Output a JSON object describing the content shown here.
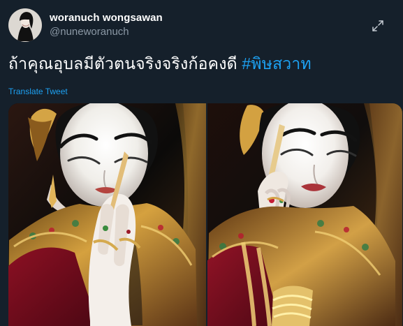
{
  "profile": {
    "display_name": "woranuch wongsawan",
    "handle": "@nuneworanuch"
  },
  "tweet": {
    "text_main": "ถ้าคุณอุบลมีตัวตนจริงจริงก้อคงดี ",
    "hashtag": "#พิษสวาท",
    "translate_label": "Translate Tweet"
  },
  "icons": {
    "expand": "expand-icon",
    "avatar": "avatar-photo"
  },
  "colors": {
    "background": "#15202b",
    "text": "#ffffff",
    "secondary_text": "#8b98a5",
    "link": "#1da1f2"
  },
  "media": {
    "images": [
      {
        "name": "photo-thai-dancer-praying",
        "description": "woman in traditional Thai costume with hands pressed together"
      },
      {
        "name": "photo-thai-dancer-makeup",
        "description": "woman in traditional Thai costume applying eyebrow makeup"
      }
    ]
  }
}
